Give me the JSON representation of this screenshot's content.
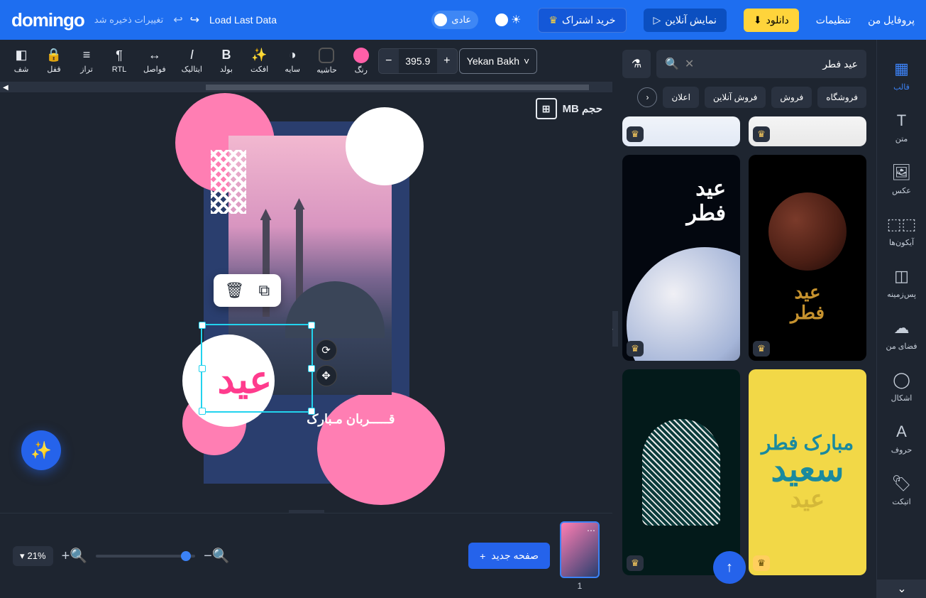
{
  "header": {
    "logo": "domingo",
    "profile": "پروفایل من",
    "settings": "تنظیمات",
    "download": "دانلود",
    "online_view": "نمایش آنلاین",
    "subscribe": "خرید اشتراک",
    "mode_normal": "عادی",
    "save_status": "تغییرات ذخیره شد",
    "load_last": "Load Last Data"
  },
  "toolbar": {
    "font_name": "Yekan Bakh",
    "font_size": "395.9",
    "color_label": "رنگ",
    "border_label": "حاشیه",
    "shadow_label": "سایه",
    "effect_label": "افکت",
    "bold_label": "بولد",
    "italic_label": "ایتالیک",
    "spacing_label": "فواصل",
    "rtl_label": "RTL",
    "align_label": "تراز",
    "lock_label": "قفل",
    "trans_label": "شف"
  },
  "sidebar": {
    "template": "قالب",
    "text": "متن",
    "image": "عکس",
    "icons": "آیکون‌ها",
    "background": "پس‌زمینه",
    "my_space": "فضای من",
    "shapes": "اشکال",
    "fonts": "حروف",
    "etiquette": "اتیکت"
  },
  "panel": {
    "search_value": "عید فطر",
    "chips": [
      "فروشگاه",
      "فروش",
      "فروش آنلاین",
      "اعلان"
    ]
  },
  "canvas": {
    "size_label": "حجم MB",
    "main_text": "عید",
    "sub_text": "قـــــربان مـبارک"
  },
  "bottom": {
    "new_page": "صفحه جدید",
    "page_number": "1",
    "zoom_percent": "21%"
  },
  "colors": {
    "accent": "#2563eb",
    "pink": "#ff5fa8",
    "yellow": "#ffd43b"
  }
}
